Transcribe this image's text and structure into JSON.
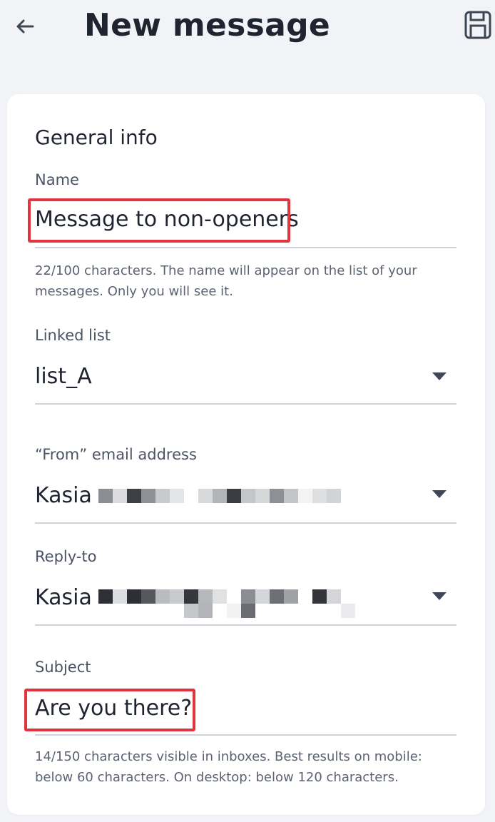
{
  "header": {
    "title": "New message",
    "back_icon": "arrow-left-icon",
    "save_icon": "floppy-disk-icon"
  },
  "general_info": {
    "section_title": "General info",
    "name": {
      "label": "Name",
      "value": "Message to non-openers",
      "helper": "22/100 characters. The name will appear on the list of your messages. Only you will see it."
    },
    "linked_list": {
      "label": "Linked list",
      "value": "list_A"
    },
    "from_email": {
      "label": "“From” email address",
      "value": "Kasia"
    },
    "reply_to": {
      "label": "Reply-to",
      "value": "Kasia"
    },
    "subject": {
      "label": "Subject",
      "value": "Are you there?",
      "helper": "14/150 characters visible in inboxes. Best results on mobile: below 60 characters. On desktop: below 120 characters."
    }
  },
  "colors": {
    "background": "#f1f3f7",
    "card": "#ffffff",
    "text": "#1f2430",
    "label": "#4b5364",
    "highlight": "#e2343f",
    "divider": "#cfd3db"
  }
}
